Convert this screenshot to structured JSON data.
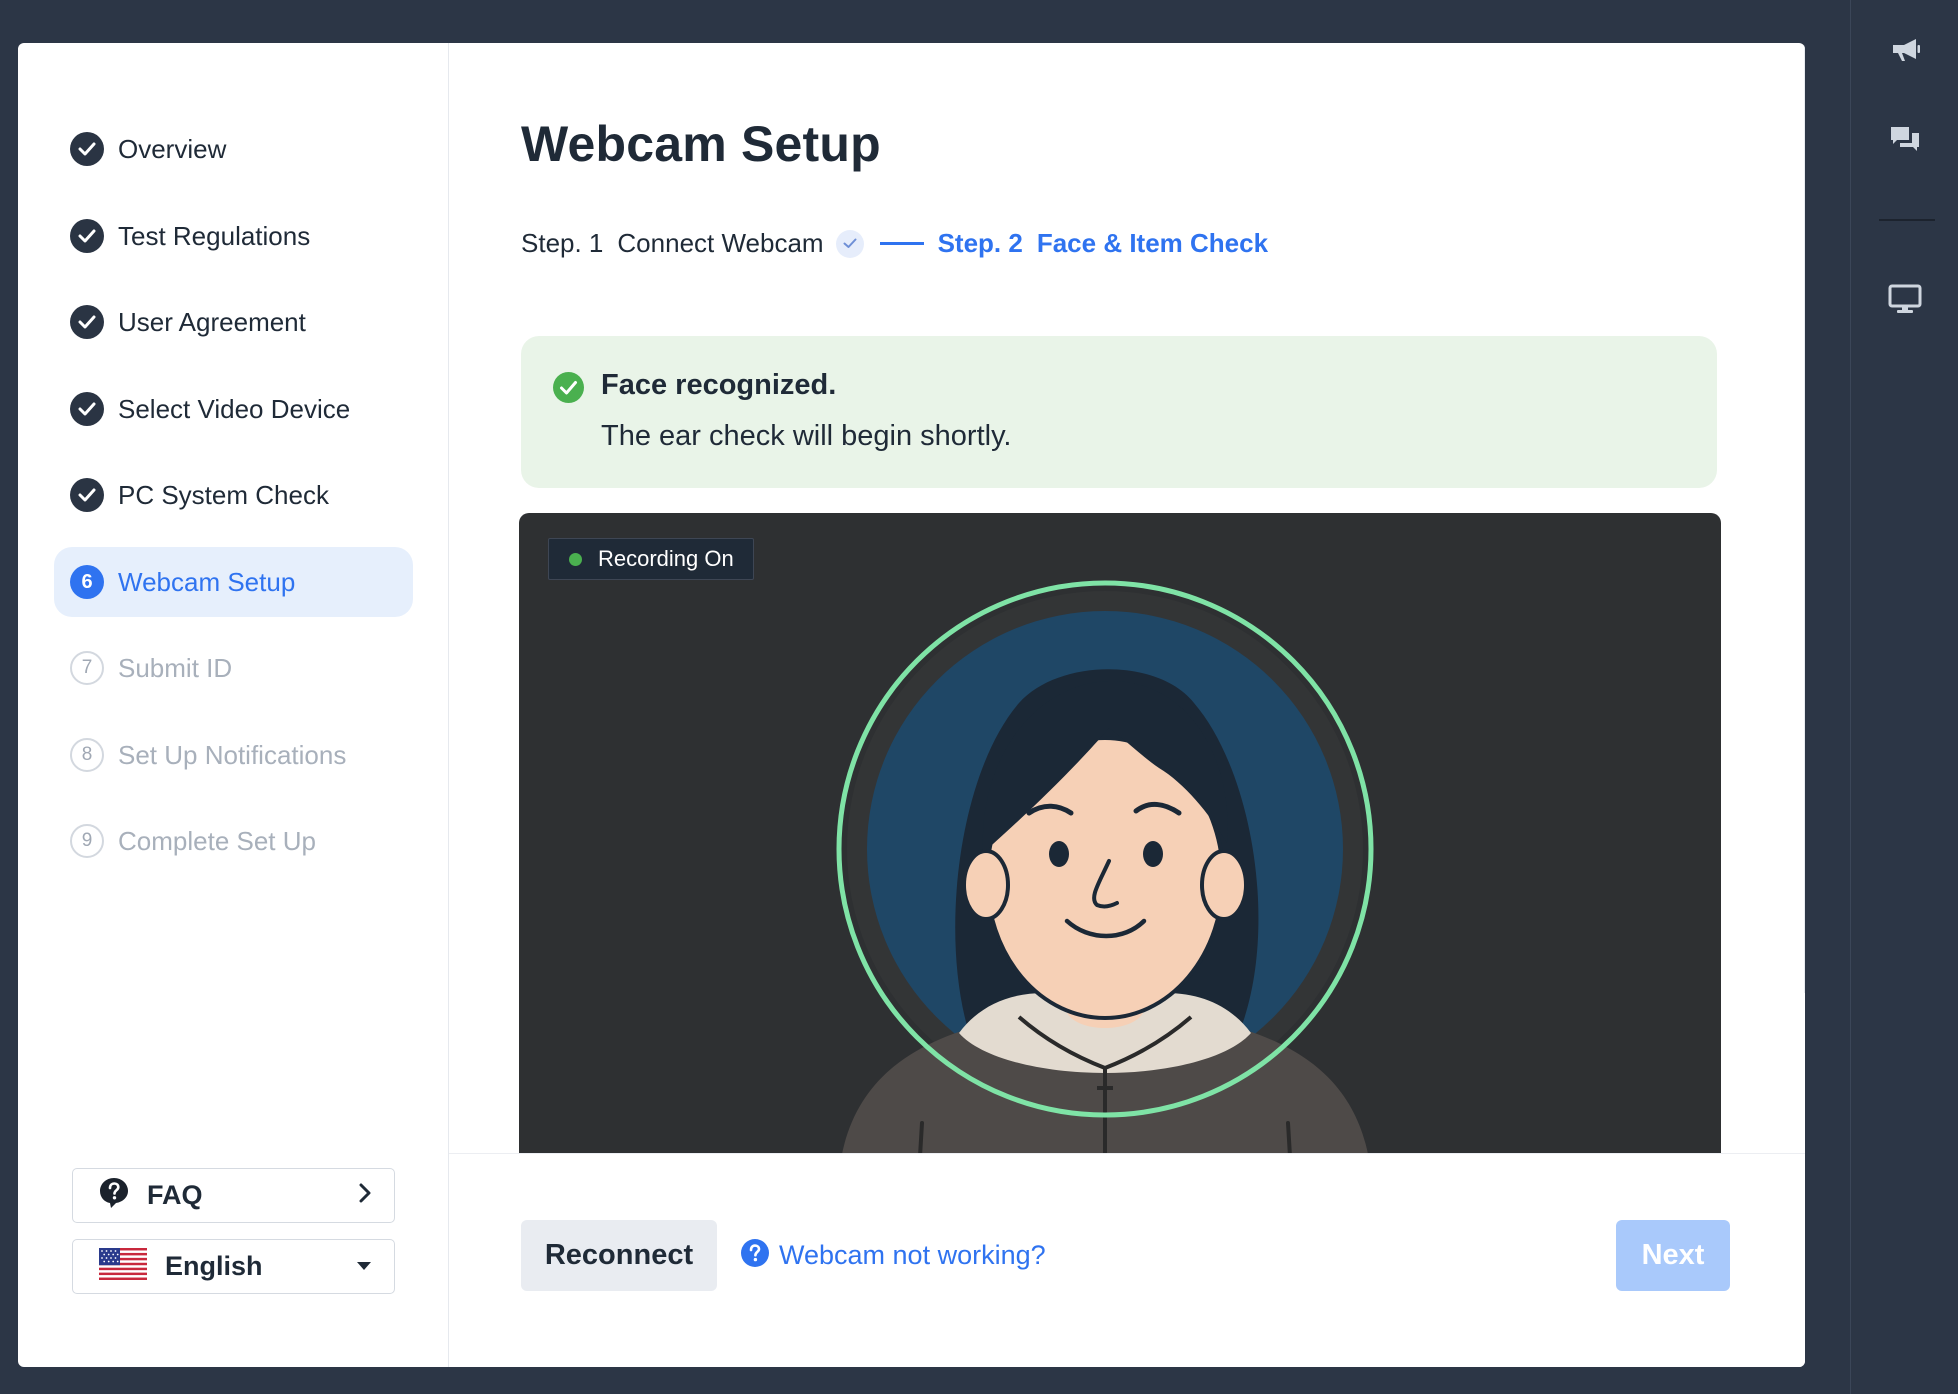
{
  "sidebar": {
    "items": [
      {
        "number": "1",
        "label": "Overview",
        "state": "done"
      },
      {
        "number": "2",
        "label": "Test Regulations",
        "state": "done"
      },
      {
        "number": "3",
        "label": "User Agreement",
        "state": "done"
      },
      {
        "number": "4",
        "label": "Select Video Device",
        "state": "done"
      },
      {
        "number": "5",
        "label": "PC System Check",
        "state": "done"
      },
      {
        "number": "6",
        "label": "Webcam Setup",
        "state": "current"
      },
      {
        "number": "7",
        "label": "Submit ID",
        "state": "pending"
      },
      {
        "number": "8",
        "label": "Set Up Notifications",
        "state": "pending"
      },
      {
        "number": "9",
        "label": "Complete Set Up",
        "state": "pending"
      }
    ],
    "faq_label": "FAQ",
    "language_label": "English"
  },
  "main": {
    "title": "Webcam Setup",
    "stepper": {
      "step1_prefix": "Step. 1",
      "step1_label": "Connect Webcam",
      "step2_prefix": "Step. 2",
      "step2_label": "Face & Item Check"
    },
    "alert": {
      "title": "Face recognized.",
      "message": "The ear check will begin shortly."
    },
    "video": {
      "recording_label": "Recording On"
    }
  },
  "footer": {
    "reconnect_label": "Reconnect",
    "help_label": "Webcam not working?",
    "next_label": "Next"
  },
  "icons": {
    "rail": [
      "megaphone-icon",
      "chat-icon",
      "monitor-icon"
    ],
    "faq": "question-bubble-icon",
    "language": "us-flag-icon"
  },
  "colors": {
    "accent": "#2f73f0",
    "success": "#4ab04f",
    "alert_background": "#e9f4e8",
    "face_ring": "#7fe3a6",
    "next_disabled": "#a9c9fb"
  }
}
